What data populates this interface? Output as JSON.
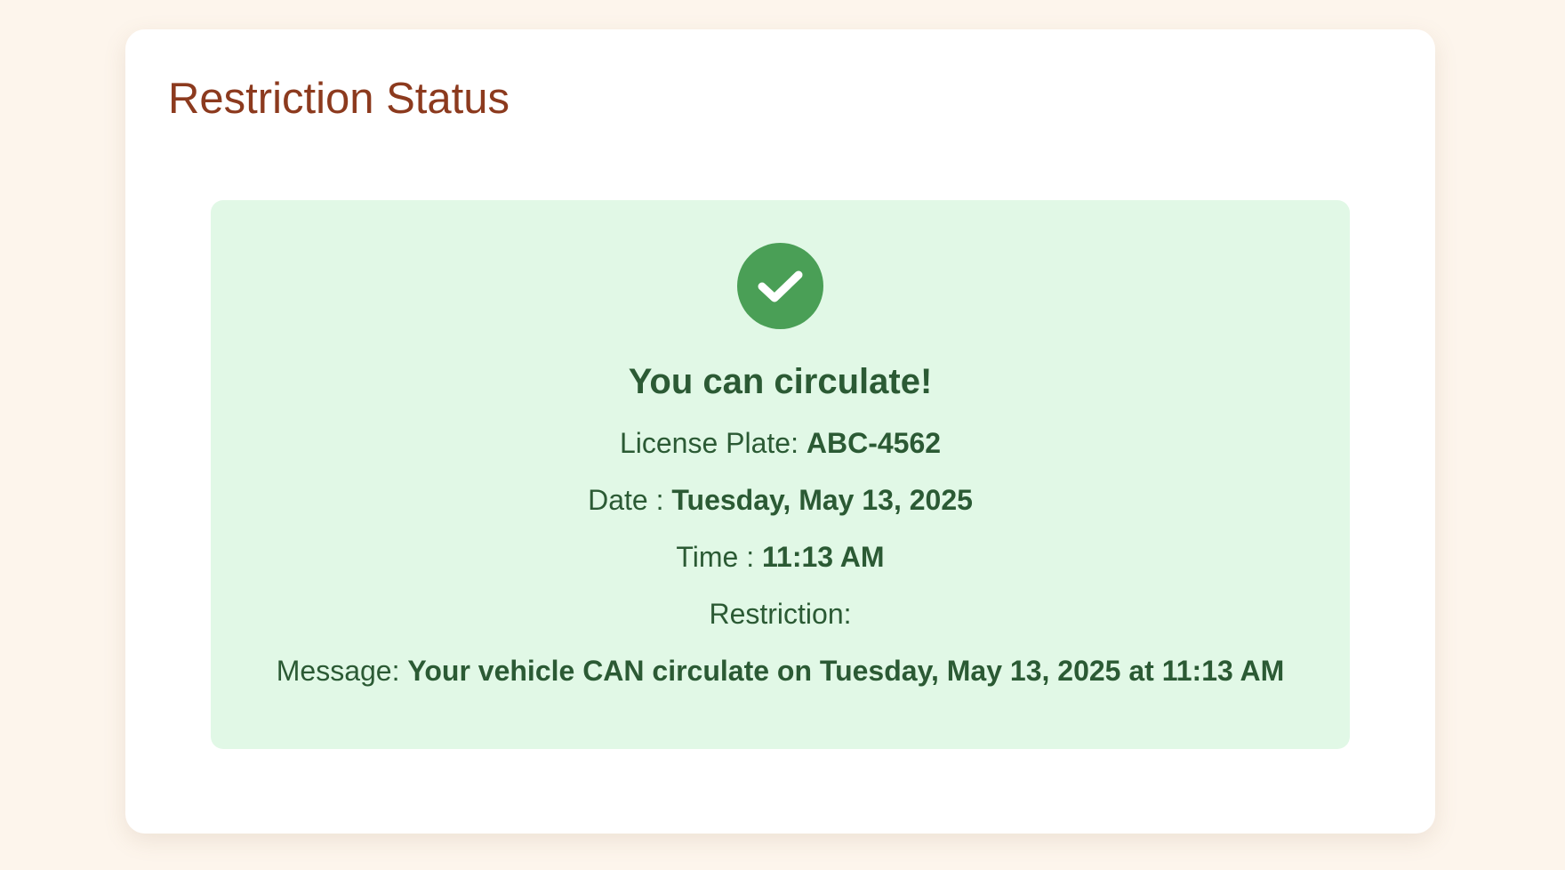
{
  "card": {
    "title": "Restriction Status"
  },
  "result": {
    "status_icon": "check-circle-icon",
    "headline": "You can circulate!",
    "plate_label": "License Plate:",
    "plate_value": "ABC-4562",
    "date_label": "Date :",
    "date_value": "Tuesday, May 13, 2025",
    "time_label": "Time :",
    "time_value": "11:13 AM",
    "restriction_label": "Restriction:",
    "restriction_value": "",
    "message_label": "Message:",
    "message_value": "Your vehicle CAN circulate on Tuesday, May 13, 2025 at 11:13 AM"
  },
  "colors": {
    "page_background": "#fdf5ec",
    "title": "#8c3a1e",
    "success_background": "#e1f8e6",
    "success_text": "#2b5a34",
    "success_icon": "#4a9f56"
  }
}
